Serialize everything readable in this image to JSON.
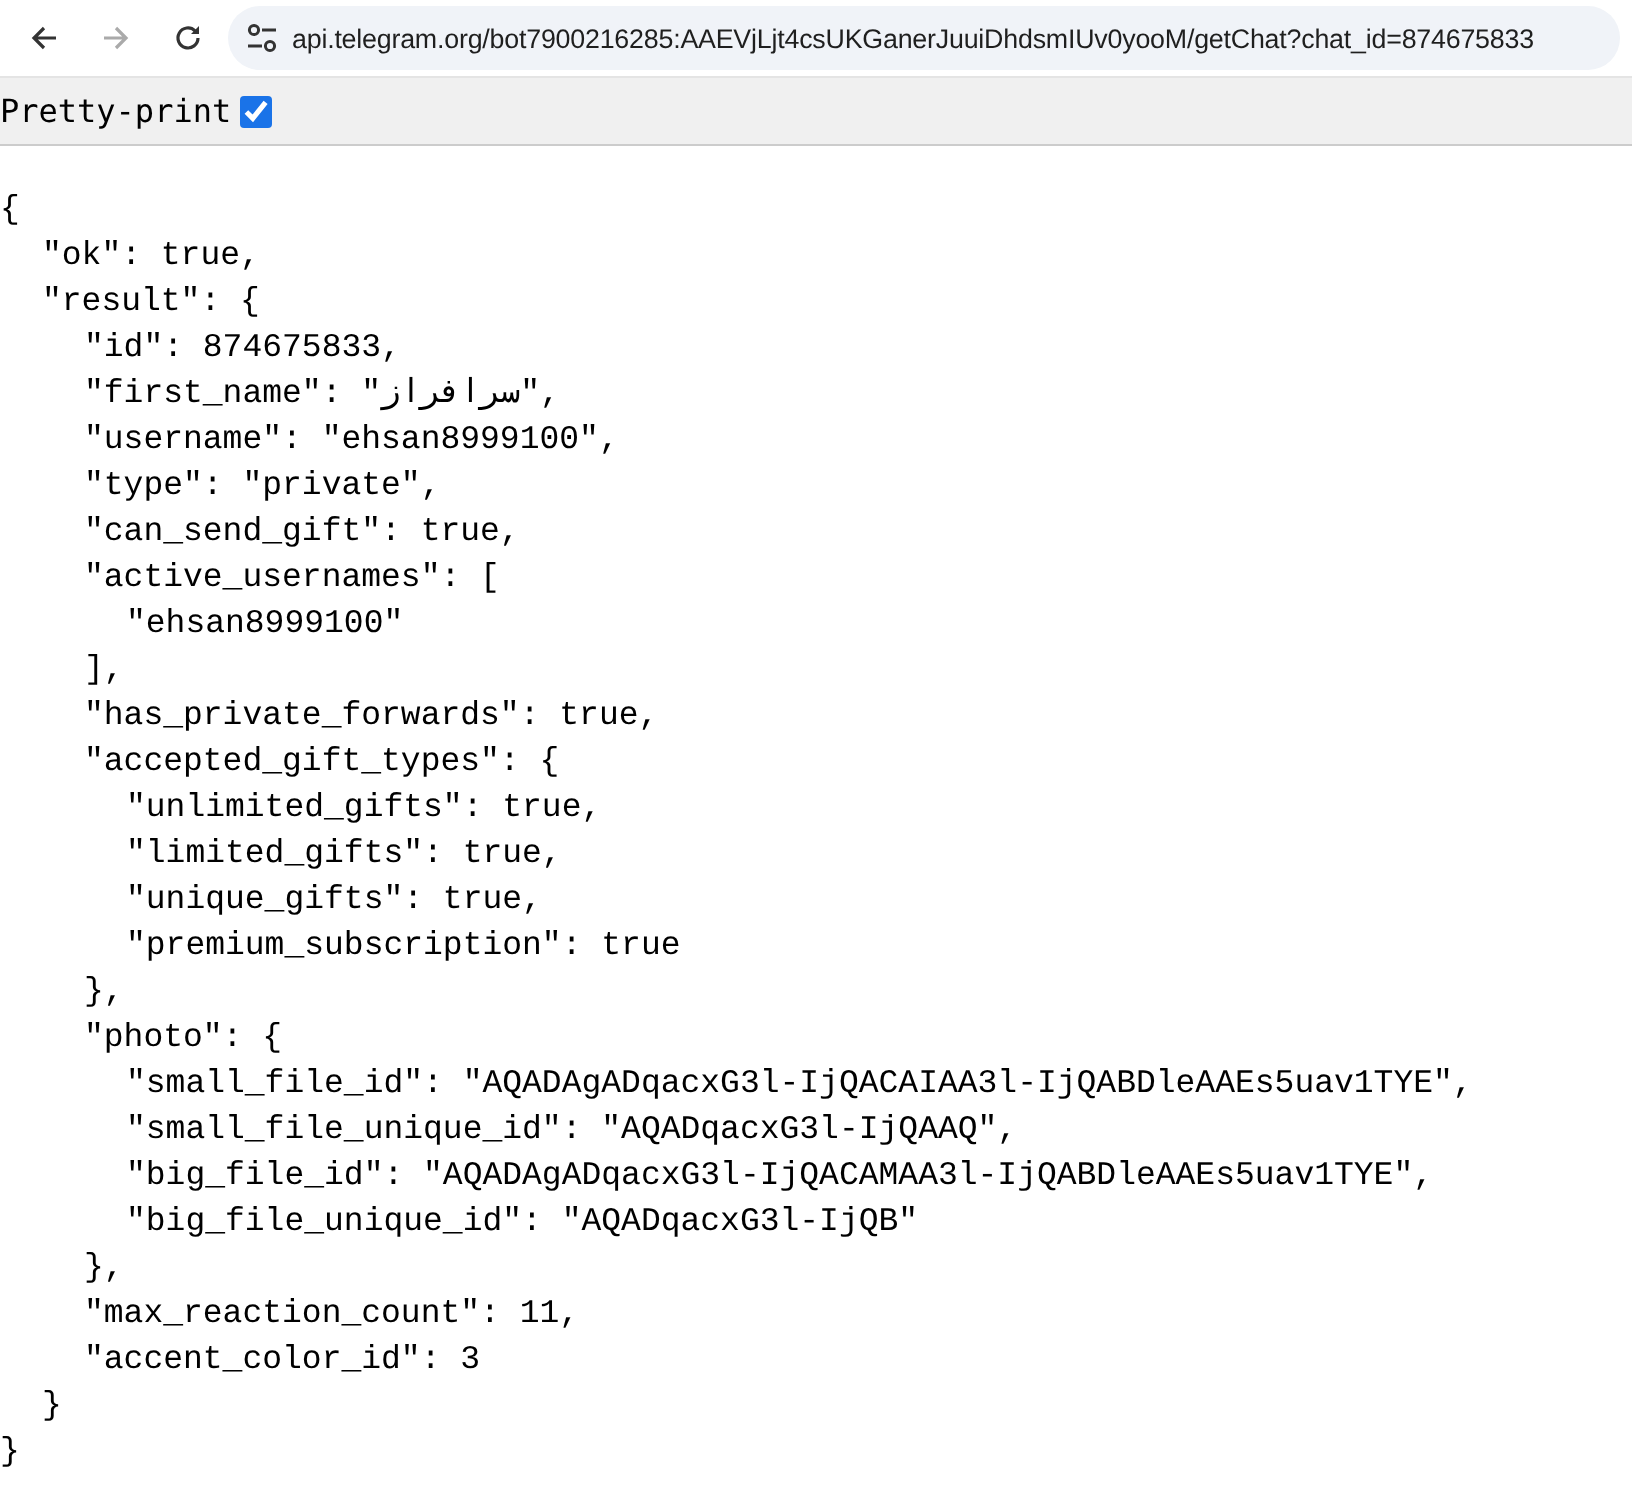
{
  "browser": {
    "back_disabled": false,
    "forward_disabled": true,
    "url": "api.telegram.org/bot7900216285:AAEVjLjt4csUKGanerJuuiDhdsmIUv0yooM/getChat?chat_id=874675833"
  },
  "pretty_print": {
    "label": "Pretty-print",
    "checked": true
  },
  "document": {
    "text": "{",
    "close": "}",
    "children": [
      {
        "text": "\"ok\": true,"
      },
      {
        "text": "\"result\": {",
        "close": "}",
        "children": [
          {
            "text": "\"id\": 874675833,"
          },
          {
            "text": "\"first_name\": \"سرافراز\","
          },
          {
            "text": "\"username\": \"ehsan8999100\","
          },
          {
            "text": "\"type\": \"private\","
          },
          {
            "text": "\"can_send_gift\": true,"
          },
          {
            "text": "\"active_usernames\": [",
            "close": "],",
            "children": [
              {
                "text": "\"ehsan8999100\""
              }
            ]
          },
          {
            "text": "\"has_private_forwards\": true,"
          },
          {
            "text": "\"accepted_gift_types\": {",
            "close": "},",
            "children": [
              {
                "text": "\"unlimited_gifts\": true,"
              },
              {
                "text": "\"limited_gifts\": true,"
              },
              {
                "text": "\"unique_gifts\": true,"
              },
              {
                "text": "\"premium_subscription\": true"
              }
            ]
          },
          {
            "text": "\"photo\": {",
            "close": "},",
            "children": [
              {
                "text": "\"small_file_id\": \"AQADAgADqacxG3l-IjQACAIAA3l-IjQABDleAAEs5uav1TYE\","
              },
              {
                "text": "\"small_file_unique_id\": \"AQADqacxG3l-IjQAAQ\","
              },
              {
                "text": "\"big_file_id\": \"AQADAgADqacxG3l-IjQACAMAA3l-IjQABDleAAEs5uav1TYE\","
              },
              {
                "text": "\"big_file_unique_id\": \"AQADqacxG3l-IjQB\""
              }
            ]
          },
          {
            "text": "\"max_reaction_count\": 11,"
          },
          {
            "text": "\"accent_color_id\": 3"
          }
        ]
      }
    ]
  }
}
